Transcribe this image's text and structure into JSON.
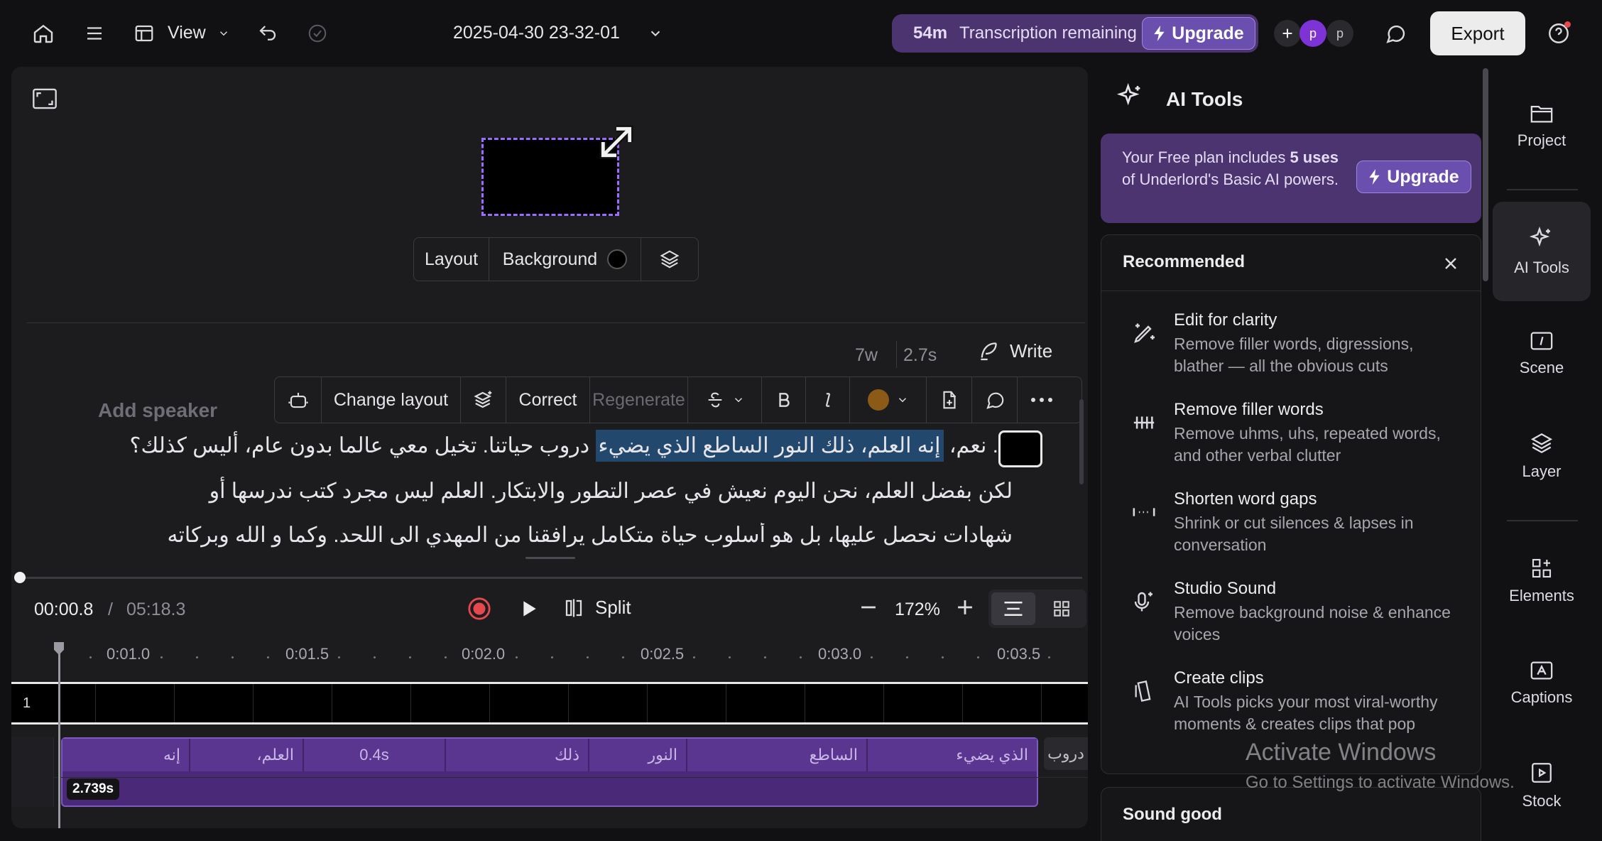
{
  "topbar": {
    "view_label": "View",
    "doc_title": "2025-04-30 23-32-01",
    "transcription_minutes": "54m",
    "transcription_label": "Transcription remaining",
    "upgrade_label": "Upgrade",
    "avatar_1": "p",
    "avatar_2": "p",
    "export_label": "Export"
  },
  "canvas": {
    "layout_label": "Layout",
    "background_label": "Background",
    "background_color": "#000000",
    "word_count": "7w",
    "duration": "2.7s",
    "write_label": "Write"
  },
  "toolbar": {
    "change_layout": "Change layout",
    "correct": "Correct",
    "regenerate": "Regenerate",
    "text_color": "#8a5a16"
  },
  "transcript": {
    "add_speaker": "Add speaker",
    "line1_prefix": ". نعم، ",
    "line1_highlight": "إنه العلم، ذلك النور الساطع الذي يضيء",
    "line1_suffix": " دروب حياتنا. تخيل معي عالما بدون عام، أليس كذلك؟",
    "line2": "لكن بفضل العلم، نحن اليوم نعيش في عصر التطور والابتكار. العلم ليس مجرد كتب ندرسها أو",
    "line3": "شهادات نحصل عليها، بل هو أسلوب حياة متكامل يرافقنا من المهدي الى اللحد. وكما و الله وبركاته"
  },
  "playback": {
    "current_time": "00:00.8",
    "separator": "/",
    "total_time": "05:18.3",
    "split_label": "Split",
    "zoom": "172%"
  },
  "timeline": {
    "ruler": [
      "0:01.0",
      "0:01.5",
      "0:02.0",
      "0:02.5",
      "0:03.0",
      "0:03.5"
    ],
    "track_number": "1",
    "words": [
      "إنه",
      "العلم،",
      "0.4s",
      "ذلك",
      "النور",
      "الساطع",
      "الذي يضيء"
    ],
    "next_word": "دروب",
    "clip_duration": "2.739s"
  },
  "ai_tools": {
    "title": "AI Tools",
    "plan_text_1": "Your Free plan includes ",
    "plan_bold": "5 uses",
    "plan_text_2": " of Underlord's Basic AI powers.",
    "upgrade_label": "Upgrade",
    "recommended_title": "Recommended",
    "items": [
      {
        "title": "Edit for clarity",
        "desc": "Remove filler words, digressions, blather — all the obvious cuts",
        "icon": "pen-sparkle-icon"
      },
      {
        "title": "Remove filler words",
        "desc": "Remove uhms, uhs, repeated words, and other verbal clutter",
        "icon": "filler-words-icon"
      },
      {
        "title": "Shorten word gaps",
        "desc": "Shrink or cut silences & lapses in conversation",
        "icon": "word-gaps-icon"
      },
      {
        "title": "Studio Sound",
        "desc": "Remove background noise & enhance voices",
        "icon": "microphone-sparkle-icon"
      },
      {
        "title": "Create clips",
        "desc": "AI Tools picks your most viral-worthy moments & creates clips that pop",
        "icon": "clips-icon"
      }
    ],
    "sound_good_title": "Sound good"
  },
  "nav": {
    "project": "Project",
    "ai_tools": "AI Tools",
    "scene": "Scene",
    "layer": "Layer",
    "elements": "Elements",
    "captions": "Captions",
    "stock": "Stock"
  },
  "watermark": {
    "line1": "Activate Windows",
    "line2": "Go to Settings to activate Windows."
  }
}
